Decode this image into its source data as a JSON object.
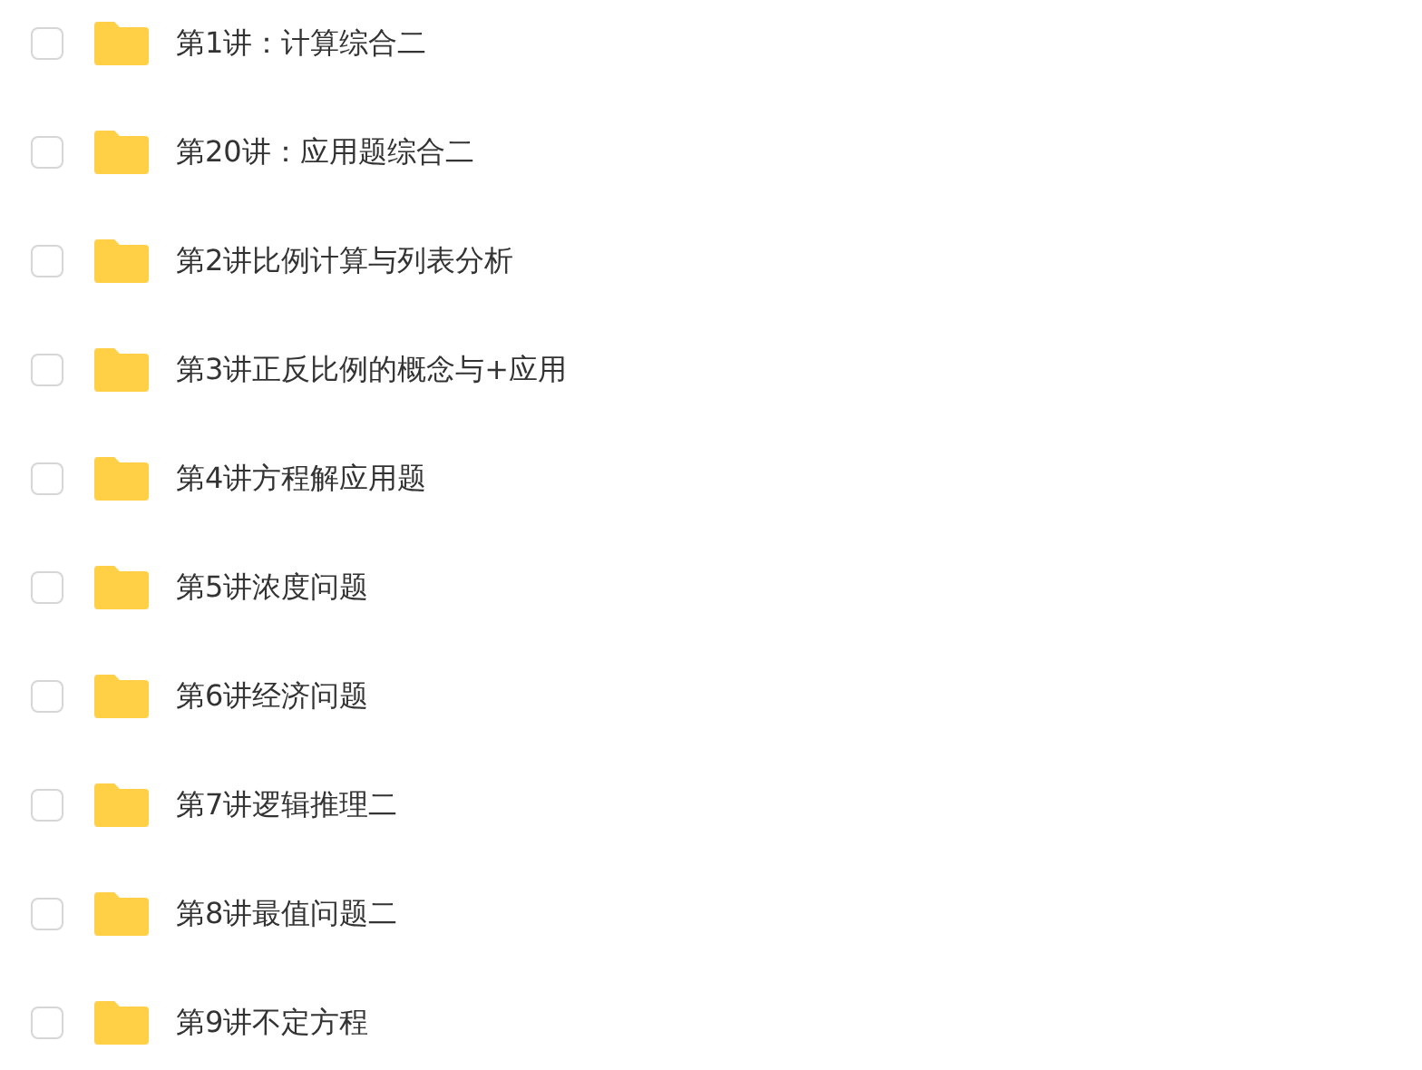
{
  "files": [
    {
      "name": "第1讲：计算综合二",
      "checked": false
    },
    {
      "name": "第20讲：应用题综合二",
      "checked": false
    },
    {
      "name": "第2讲比例计算与列表分析",
      "checked": false
    },
    {
      "name": "第3讲正反比例的概念与+应用",
      "checked": false
    },
    {
      "name": "第4讲方程解应用题",
      "checked": false
    },
    {
      "name": "第5讲浓度问题",
      "checked": false
    },
    {
      "name": "第6讲经济问题",
      "checked": false
    },
    {
      "name": "第7讲逻辑推理二",
      "checked": false
    },
    {
      "name": "第8讲最值问题二",
      "checked": false
    },
    {
      "name": "第9讲不定方程",
      "checked": false
    }
  ]
}
